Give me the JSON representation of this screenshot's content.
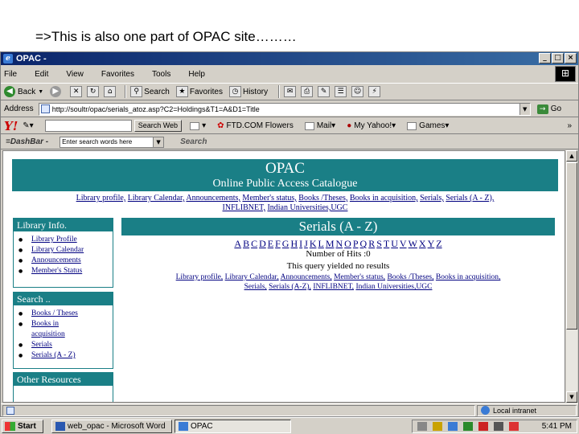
{
  "caption": "=>This is also one part of OPAC site………",
  "window": {
    "title": "OPAC -",
    "controls": [
      "_",
      "□",
      "×"
    ]
  },
  "menu": [
    "File",
    "Edit",
    "View",
    "Favorites",
    "Tools",
    "Help"
  ],
  "toolbar": {
    "back": "Back",
    "search": "Search",
    "favorites": "Favorites",
    "history": "History"
  },
  "address": {
    "label": "Address",
    "url": "http://soultr/opac/serials_atoz.asp?C2=Holdings&T1=A&D1=Title",
    "go": "Go"
  },
  "yahoo": {
    "logo": "Y!",
    "search_button": "Search Web",
    "flowers": "FTD.COM Flowers",
    "mail": "Mail",
    "my_yahoo": "My Yahoo!",
    "games": "Games",
    "more": "»"
  },
  "dashbar": {
    "label": "=DashBar -",
    "placeholder": "Enter search words here",
    "search": "Search"
  },
  "page": {
    "banner_title": "OPAC",
    "banner_subtitle": "Online Public Access Catalogue",
    "top_links": [
      "Library profile,",
      "Library Calendar,",
      "Announcements,",
      "Member's status,",
      "Books /Theses,",
      "Books in acquisition,",
      "Serials,",
      "Serials (A - Z),",
      "INFLIBNET,",
      "Indian Universities,UGC"
    ],
    "library_info": {
      "heading": "Library Info.",
      "items": [
        "Library Profile",
        "Library Calendar",
        "Announcements",
        "Member's Status"
      ]
    },
    "search_box": {
      "heading": "Search ..",
      "items": [
        "Books / Theses",
        "Books in acquisition",
        "Serials",
        "Serials (A - Z)"
      ]
    },
    "other_heading": "Other Resources",
    "serials_heading": "Serials (A - Z)",
    "alphabet": [
      "A",
      "B",
      "C",
      "D",
      "E",
      "F",
      "G",
      "H",
      "I",
      "J",
      "K",
      "L",
      "M",
      "N",
      "O",
      "P",
      "Q",
      "R",
      "S",
      "T",
      "U",
      "V",
      "W",
      "X",
      "Y",
      "Z"
    ],
    "hits": "Number of Hits :0",
    "no_results": "This query yielded no results",
    "bottom_links": [
      "Library profile,",
      "Library Calendar,",
      "Announcements,",
      "Member's status,",
      "Books /Theses,",
      "Books in acquisition,",
      "Serials,",
      "Serials (A-Z),",
      "INFLIBNET,",
      "Indian Universities,UGC"
    ]
  },
  "status": {
    "zone": "Local intranet"
  },
  "taskbar": {
    "start": "Start",
    "tasks": [
      "web_opac - Microsoft Word",
      "OPAC"
    ],
    "clock": "5:41 PM"
  }
}
